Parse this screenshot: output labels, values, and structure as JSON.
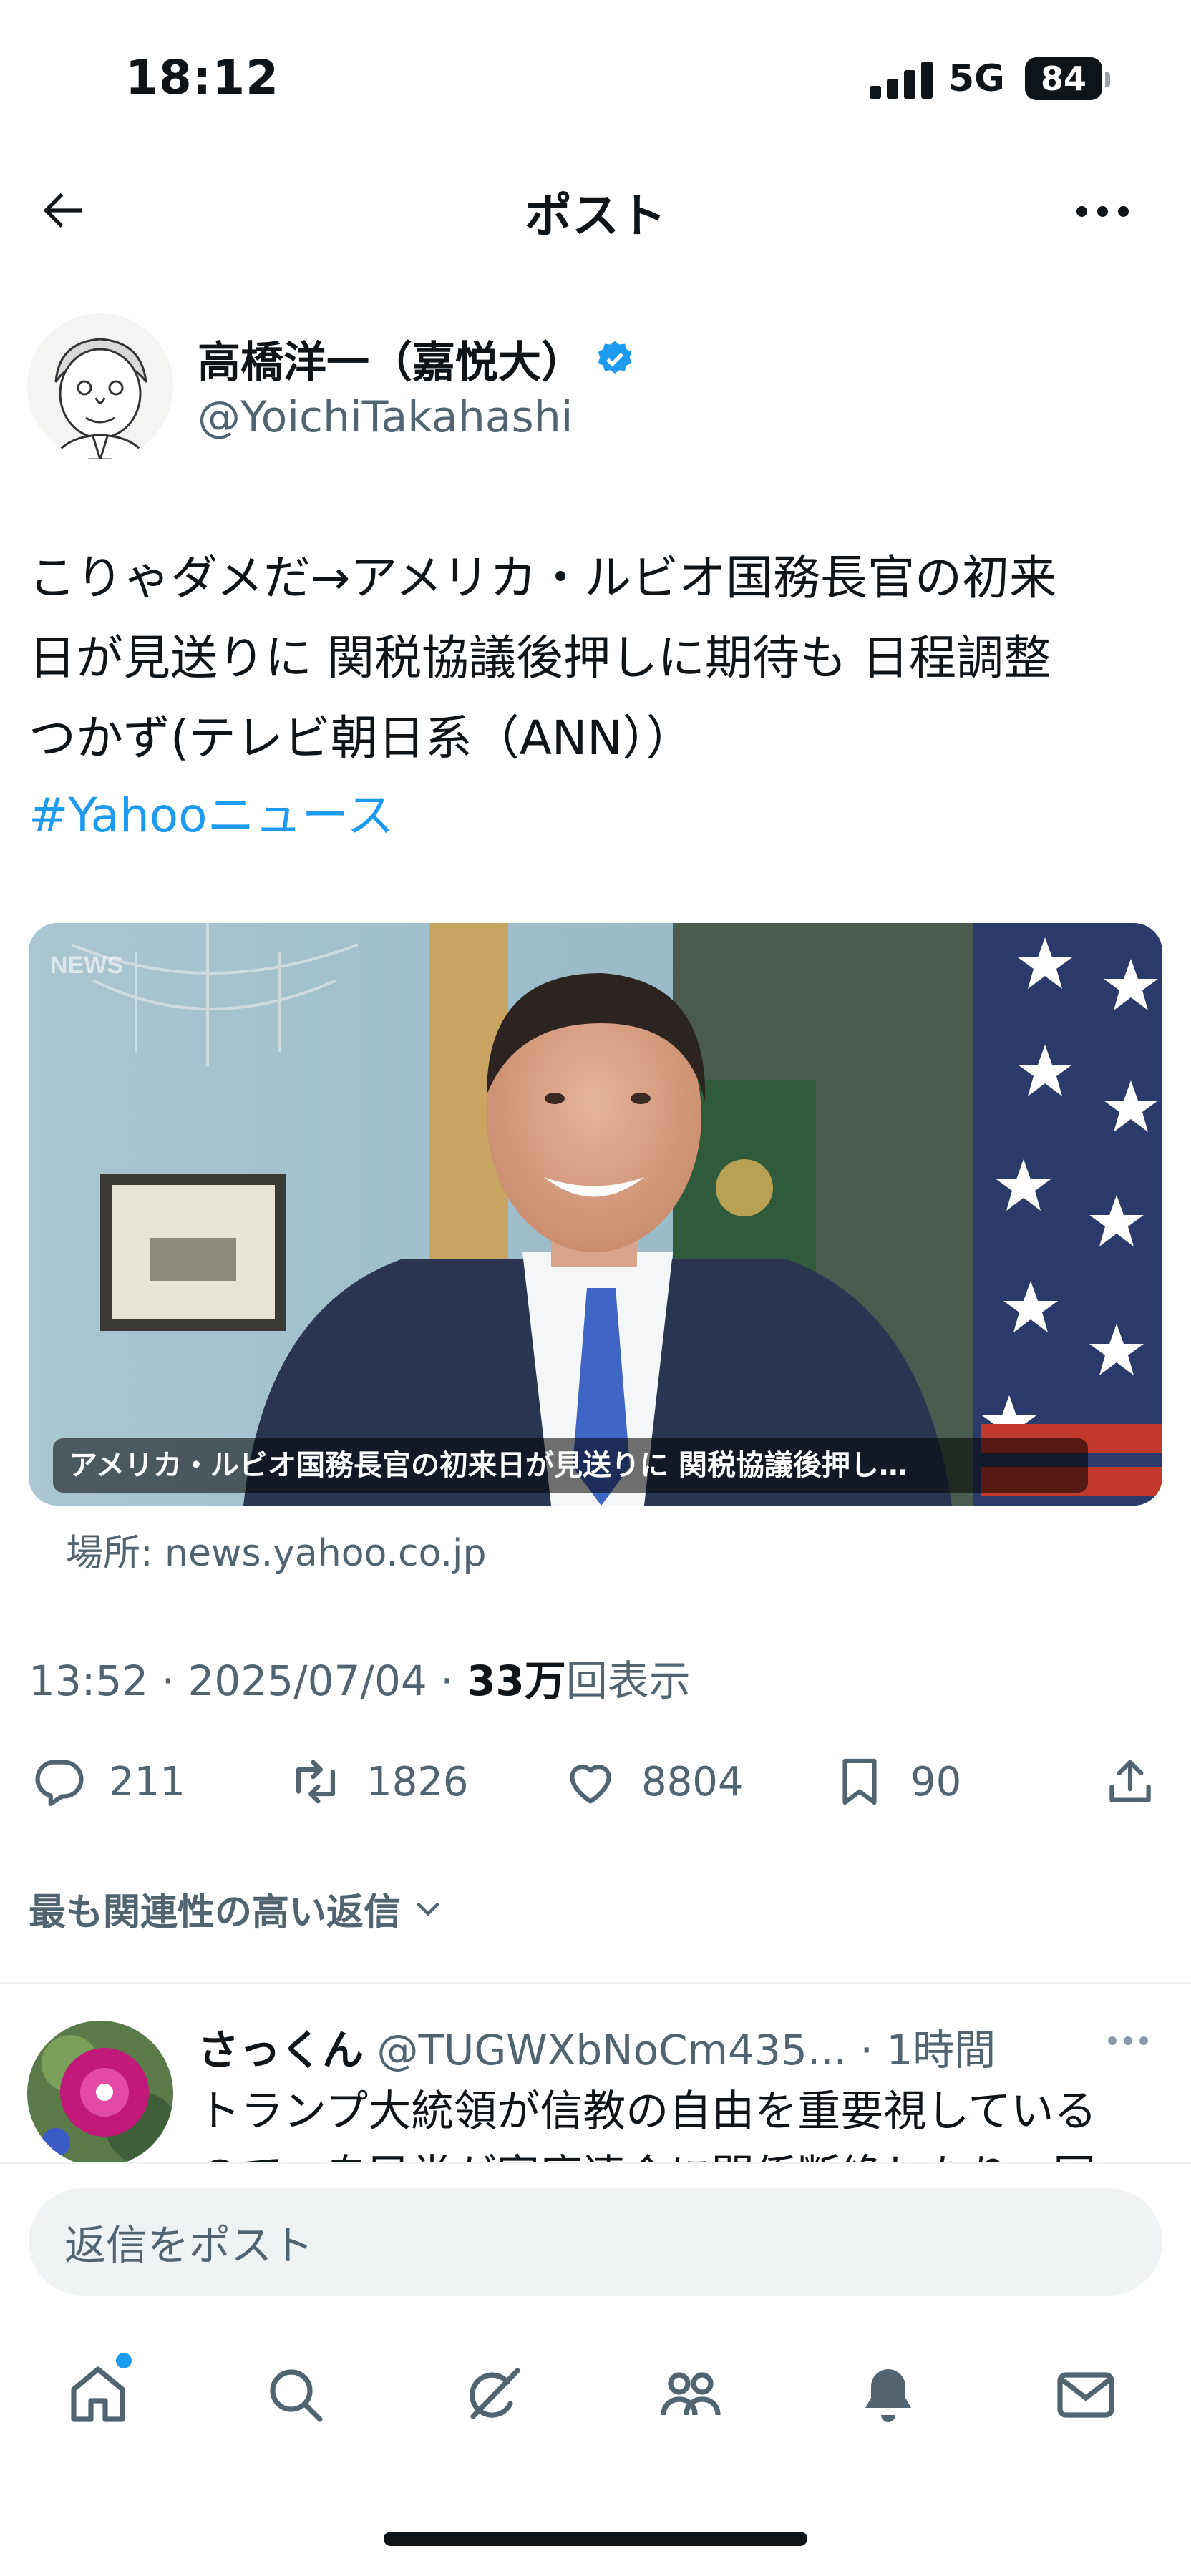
{
  "status_bar": {
    "time": "18:12",
    "network": "5G",
    "battery": "84"
  },
  "header": {
    "title": "ポスト"
  },
  "post": {
    "author_name": "高橋洋一（嘉悦大）",
    "author_handle": "@YoichiTakahashi",
    "text_lines": [
      "こりゃダメだ→アメリカ・ルビオ国務長官の初来",
      "日が見送りに 関税協議後押しに期待も 日程調整",
      "つかず(テレビ朝日系（ANN））"
    ],
    "hashtag": "#Yahooニュース",
    "card": {
      "caption": "アメリカ・ルビオ国務長官の初来日が見送りに 関税協議後押し…",
      "watermark": "NEWS",
      "source": "場所: news.yahoo.co.jp"
    },
    "meta": {
      "time": "13:52",
      "separator": "·",
      "date": "2025/07/04",
      "views_count": "33万",
      "views_label": "回表示"
    },
    "stats": {
      "replies": "211",
      "reposts": "1826",
      "likes": "8804",
      "bookmarks": "90"
    }
  },
  "replies_section": {
    "sort_label": "最も関連性の高い返信"
  },
  "reply": {
    "name": "さっくん",
    "handle": "@TUGWXbNoCm435...",
    "time": "· 1時間",
    "text_line1": "トランプ大統領が信教の自由を重要視している",
    "text_line2": "ので、自民党が家庭連合に関係断絶したり、国"
  },
  "composer": {
    "placeholder": "返信をポスト"
  },
  "colors": {
    "accent": "#1d9bf0",
    "secondary_text": "#536471",
    "primary_text": "#0f1419"
  },
  "nav": {
    "items": [
      "home-icon",
      "search-icon",
      "grok-icon",
      "communities-icon",
      "notifications-icon",
      "messages-icon"
    ]
  }
}
